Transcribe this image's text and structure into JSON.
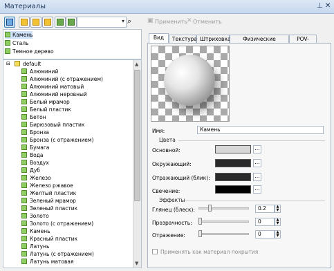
{
  "window": {
    "title": "Материалы",
    "pin_icon": "pin-icon",
    "close_icon": "close-icon"
  },
  "toolbar": {
    "apply_label": "Применить",
    "cancel_label": "Отменить",
    "search_icon": "search-icon"
  },
  "scenes": [
    "Камень",
    "Сталь",
    "Темное дерево"
  ],
  "tree": {
    "root": "default",
    "items": [
      "Алюминий",
      "Алюминий (с отражением)",
      "Алюминий матовый",
      "Алюминий неровный",
      "Белый мрамор",
      "Белый пластик",
      "Бетон",
      "Бирюзовый пластик",
      "Бронза",
      "Бронза (с отражением)",
      "Бумага",
      "Вода",
      "Воздух",
      "Дуб",
      "Железо",
      "Железо ржавое",
      "Желтый пластик",
      "Зеленый мрамор",
      "Зеленый пластик",
      "Золото",
      "Золото (с отражением)",
      "Камень",
      "Красный пластик",
      "Латунь",
      "Латунь (с отражением)",
      "Латунь матовая"
    ]
  },
  "tabs": [
    "Вид",
    "Текстура",
    "Штриховка",
    "Физические свойства",
    "POV-Ray"
  ],
  "form": {
    "name_label": "Имя:",
    "name_value": "Камень",
    "colors_group": "Цвета",
    "base_label": "Основной:",
    "ambient_label": "Окружающий:",
    "specular_label": "Отражающий (блик):",
    "emission_label": "Свечение:",
    "dots": "...",
    "effects_group": "Эффекты",
    "gloss_label": "Глянец (блеск):",
    "gloss_value": "0.2",
    "transparency_label": "Прозрачность:",
    "transparency_value": "0",
    "reflection_label": "Отражение:",
    "reflection_value": "0",
    "cover_label": "Применять как материал покрытия"
  },
  "colors": {
    "base": "#d7d7d7",
    "ambient": "#2a2a2a",
    "specular": "#2a2a2a",
    "emission": "#000000"
  }
}
